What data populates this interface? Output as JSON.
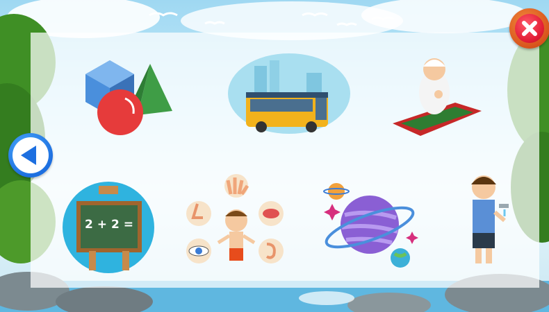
{
  "background": {
    "sky": "#bfe6f6",
    "grass": "#4d9a2a",
    "water": "#5fb7e0",
    "rock": "#7c8a90"
  },
  "controls": {
    "close_icon": "close-icon",
    "back_icon": "triangle-left-icon"
  },
  "tiles": [
    {
      "id": "shapes",
      "icon": "3d-shapes-icon"
    },
    {
      "id": "transport",
      "icon": "bus-icon"
    },
    {
      "id": "prayer",
      "icon": "praying-boy-icon"
    },
    {
      "id": "math",
      "icon": "chalkboard-icon",
      "board_text": "2 + 2 ="
    },
    {
      "id": "senses",
      "icon": "body-senses-icon"
    },
    {
      "id": "space",
      "icon": "planet-icon"
    },
    {
      "id": "wudu",
      "icon": "washing-hands-boy-icon"
    }
  ]
}
